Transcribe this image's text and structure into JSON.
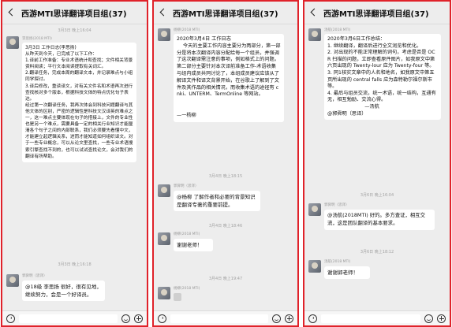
{
  "panels": [
    {
      "title": "西游MTI思译翻译项目组(37)",
      "items": [
        {
          "ts": "3月3日 晚上16:04"
        },
        {
          "sender": "李思扬(2018 MTI)",
          "text": "3月3日 工作日志(李思扬)\n从昨天到今天，已完成了以下工作：\n1.译前工作准备：专业术语统计和查找；文件相关背景资料阅读；平行文本阅读提取有关词汇。\n2.翻译任务，完成本周的翻译文本，并记录难点与小组同学探讨。\n3.译后修改，重读译文，对有关文件名和术语再次进行查找核对多个版本，根据科技文体的特点优化句子表达。\n经过第一次翻译任务，我再次体会到科技问题翻译与其他文体的区别，严密的逻辑性是科技文汉译英的难点之一，这一难点主要体现在句子的搭接上，文件的专业性也是另一个难点，需要具备一定的相关行业知识才能厘清各个句子之间的内部联系，我们必须要先看懂中文，才能建立起逻辑关系，进而才能知道如何组织译文。对于一些专业概念，可以从论文里查找，一些专业术语搜索引擎查找不到的，也可以试试查找论文，会对我们的翻译有所帮助。"
        },
        {
          "ts": "3月3日 晚上16:18"
        },
        {
          "sender": "郭舜明（思译）",
          "text": "@18级 李思扬 很好，很有见地，继续努力，会是一个好译员。"
        }
      ]
    },
    {
      "title": "西游MTI思译翻译项目组(37)",
      "items": [
        {
          "sender": "杨柳(2018 MTI)",
          "text": "2020年3月4日 工作日志\n    今天的主要工作内容主要分为两部分，第一部分是将本次翻译内容分配给每一个组员，并强调了这次翻译需注意的事项，例如格式上的问题。第二部分主要针对本次译前准备工作-术语收集与组内成员共同讨论了，本组成员建议应该从了解译文件和译文背景开始，在谷歌上了解到了文件及其作品的相关情况，而收集术语的途径有 cnki、UNTERM、TermOnline 等网站。\n\n\n—一杨柳"
        },
        {
          "ts": "3月4日 晚上18:15"
        },
        {
          "sender": "郭舜明（思译）",
          "text": "@杨柳 了解作者和必要的背景知识是翻译专著的重要前提。"
        },
        {
          "ts": "3月4日 晚上18:46"
        },
        {
          "sender": "杨柳(2018 MTI)",
          "text": "谢谢老师！"
        },
        {
          "ts": "3月4日 晚上19:47"
        },
        {
          "sender": "杨柳(2018 MTI)",
          "image": true
        }
      ]
    },
    {
      "title": "西游MTI思译翻译项目组(37)",
      "items": [
        {
          "sender": "汤航(2018 MTI)",
          "text": "2020年3月6日工作总结：\n1. 继续翻译，翻译后进行全文润览和优化。\n2. 对出现的不能正常理解的词句，考虑是否是 OCR 扫描的问题，立即查看原件图片，如我原文中第六页出现的 Twenty-lour 应为 Twenty-four 等。\n3. 同1核实文章中的人名和地名，如我原文中第五页所出现的 central falls 应为森特勒尔福尔斯市等。\n4. 最后与组员交流，统一术语，统一结构，互通有无，相互勉励、交流心得。\n                        —汤航\n@郭舜明（思译）"
        },
        {
          "ts": "3月6日 晚上16:04"
        },
        {
          "sender": "郭舜明（思译）",
          "text": "@汤航(2018MTI) 好的。多方查证，相互交流，这是团队翻译的基本要求。"
        },
        {
          "ts": "3月6日 晚上18:12"
        },
        {
          "sender": "汤航(2018 MTI)",
          "text": "谢谢郭老师！"
        }
      ]
    }
  ]
}
